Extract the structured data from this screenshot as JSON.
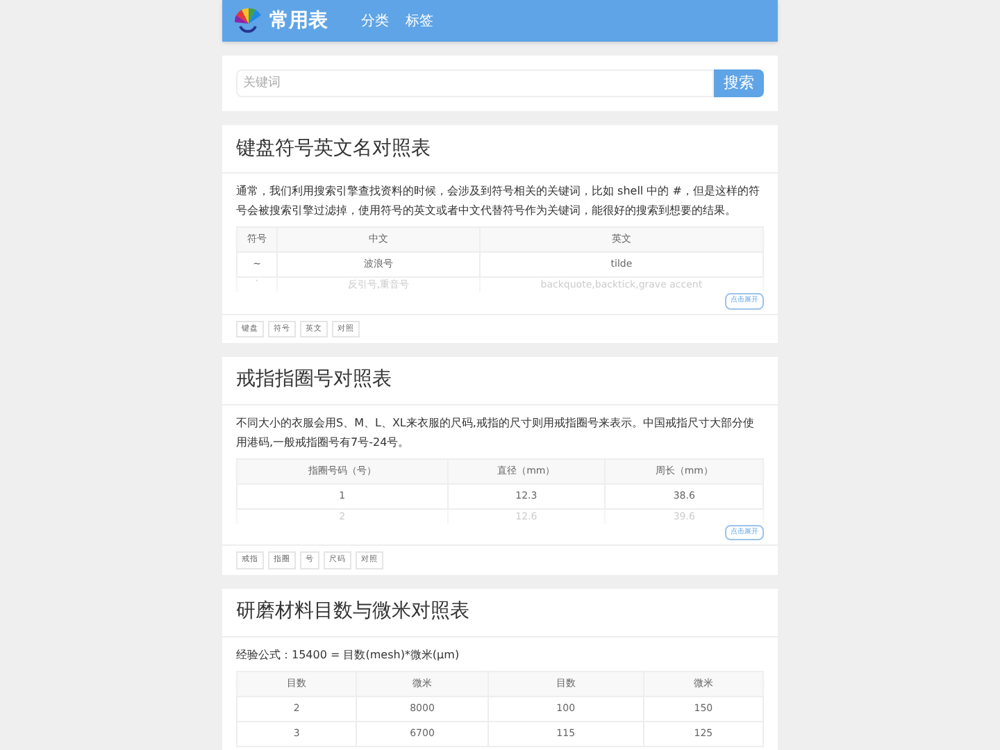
{
  "header": {
    "logo_text": "常用表",
    "nav": [
      {
        "label": "分类"
      },
      {
        "label": "标签"
      }
    ]
  },
  "search": {
    "placeholder": "关键词",
    "button": "搜索"
  },
  "cards": [
    {
      "title": "键盘符号英文名对照表",
      "description": "通常，我们利用搜索引擎查找资料的时候，会涉及到符号相关的关键词，比如 shell 中的 #，但是这样的符号会被搜索引擎过滤掉，使用符号的英文或者中文代替符号作为关键词，能很好的搜索到想要的结果。",
      "table": {
        "columns": [
          "符号",
          "中文",
          "英文"
        ],
        "rows": [
          [
            "~",
            "波浪号",
            "tilde"
          ],
          [
            "`",
            "反引号,重音号",
            "backquote,backtick,grave accent"
          ]
        ]
      },
      "expand_button": "点击展开",
      "tags": [
        "键盘",
        "符号",
        "英文",
        "对照"
      ]
    },
    {
      "title": "戒指指圈号对照表",
      "description": "不同大小的衣服会用S、M、L、XL来衣服的尺码,戒指的尺寸则用戒指圈号来表示。中国戒指尺寸大部分使用港码,一般戒指圈号有7号-24号。",
      "table": {
        "columns": [
          "指圈号码（号）",
          "直径（mm）",
          "周长（mm）"
        ],
        "rows": [
          [
            "1",
            "12.3",
            "38.6"
          ],
          [
            "2",
            "12.6",
            "39.6"
          ]
        ]
      },
      "expand_button": "点击展开",
      "tags": [
        "戒指",
        "指圈",
        "号",
        "尺码",
        "对照"
      ]
    },
    {
      "title": "研磨材料目数与微米对照表",
      "description": "经验公式：15400 = 目数(mesh)*微米(μm)",
      "table": {
        "columns": [
          "目数",
          "微米",
          "目数",
          "微米"
        ],
        "rows": [
          [
            "2",
            "8000",
            "100",
            "150"
          ],
          [
            "3",
            "6700",
            "115",
            "125"
          ]
        ]
      }
    }
  ]
}
